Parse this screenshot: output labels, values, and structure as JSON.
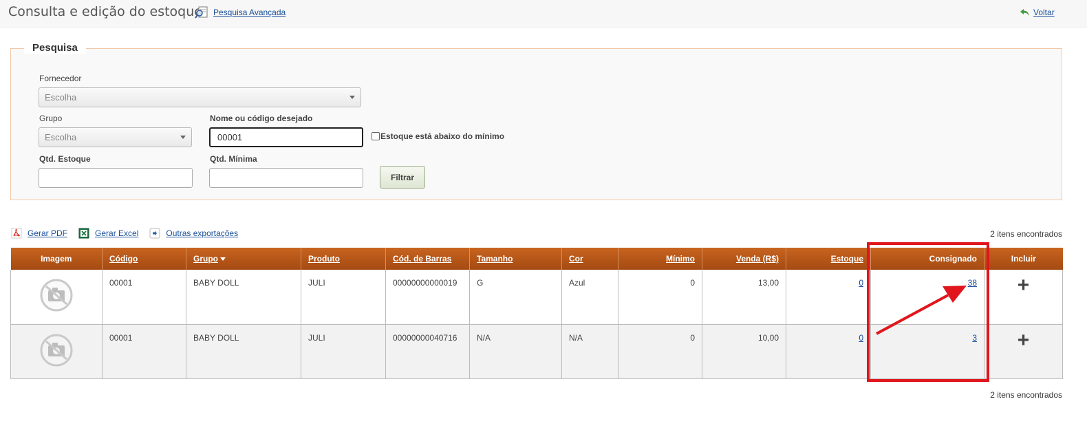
{
  "header": {
    "title": "Consulta e edição do estoque",
    "advanced_search": "Pesquisa Avançada",
    "back": "Voltar"
  },
  "search": {
    "legend": "Pesquisa",
    "fornecedor_label": "Fornecedor",
    "fornecedor_value": "Escolha",
    "grupo_label": "Grupo",
    "grupo_value": "Escolha",
    "nome_label": "Nome ou código desejado",
    "nome_value": "00001",
    "estoque_minimo_label": "Estoque está abaixo do mínimo",
    "qtd_estoque_label": "Qtd. Estoque",
    "qtd_minima_label": "Qtd. Mínima",
    "filter_button": "Filtrar"
  },
  "exports": {
    "pdf": "Gerar PDF",
    "excel": "Gerar Excel",
    "other": "Outras exportações"
  },
  "results_count": "2 itens encontrados",
  "table": {
    "columns": [
      "Imagem",
      "Código",
      "Grupo",
      "Produto",
      "Cód. de Barras",
      "Tamanho",
      "Cor",
      "Mínimo",
      "Venda (R$)",
      "Estoque",
      "Consignado",
      "Incluir"
    ],
    "rows": [
      {
        "codigo": "00001",
        "grupo": "BABY DOLL",
        "produto": "JULI",
        "barras": "00000000000019",
        "tamanho": "G",
        "cor": "Azul",
        "minimo": "0",
        "venda": "13,00",
        "estoque": "0",
        "consignado": "38",
        "incluir": "+"
      },
      {
        "codigo": "00001",
        "grupo": "BABY DOLL",
        "produto": "JULI",
        "barras": "00000000040716",
        "tamanho": "N/A",
        "cor": "N/A",
        "minimo": "0",
        "venda": "10,00",
        "estoque": "0",
        "consignado": "3",
        "incluir": "+"
      }
    ]
  },
  "icons": {
    "advanced_search": "search-document-icon",
    "back": "back-arrow-icon",
    "pdf": "pdf-icon",
    "excel": "excel-icon",
    "other": "export-arrow-icon",
    "image": "no-camera-icon",
    "include": "plus-icon"
  },
  "colors": {
    "header_orange": "#b5561a",
    "highlight_red": "#e0161c",
    "link_blue": "#1a4f99"
  }
}
